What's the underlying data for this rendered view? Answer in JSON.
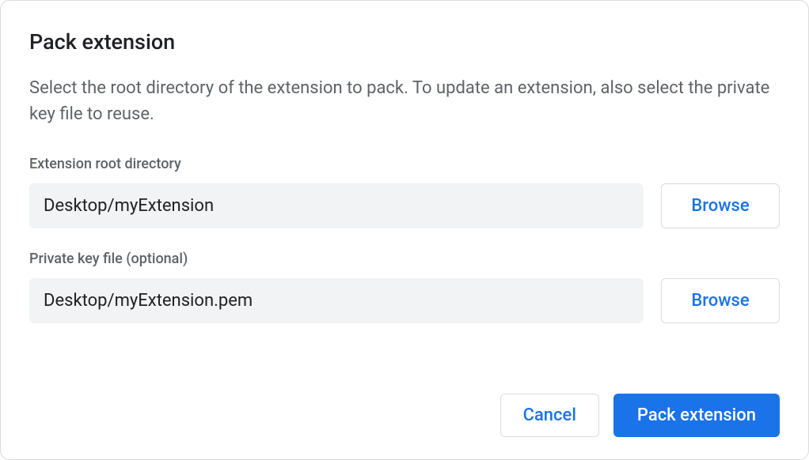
{
  "title": "Pack extension",
  "description": "Select the root directory of the extension to pack. To update an extension, also select the private key file to reuse.",
  "fields": {
    "root": {
      "label": "Extension root directory",
      "value": "Desktop/myExtension",
      "browse": "Browse"
    },
    "key": {
      "label": "Private key file (optional)",
      "value": "Desktop/myExtension.pem",
      "browse": "Browse"
    }
  },
  "actions": {
    "cancel": "Cancel",
    "pack": "Pack extension"
  }
}
